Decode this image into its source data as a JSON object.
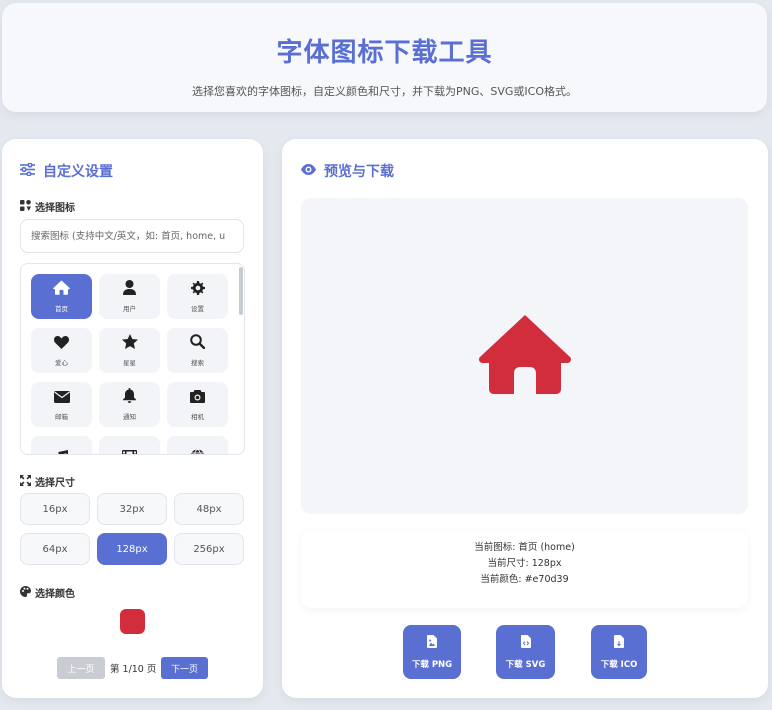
{
  "header": {
    "title": "字体图标下载工具",
    "subtitle": "选择您喜欢的字体图标，自定义颜色和尺寸，并下载为PNG、SVG或ICO格式。"
  },
  "left_panel": {
    "title": "自定义设置",
    "select_icon_label": "选择图标",
    "search_placeholder": "搜索图标 (支持中文/英文，如: 首页, home, u",
    "icons": [
      {
        "name": "home-icon",
        "label": "首页",
        "active": true
      },
      {
        "name": "user-icon",
        "label": "用户",
        "active": false
      },
      {
        "name": "gear-icon",
        "label": "设置",
        "active": false
      },
      {
        "name": "heart-icon",
        "label": "爱心",
        "active": false
      },
      {
        "name": "star-icon",
        "label": "星星",
        "active": false
      },
      {
        "name": "search-icon",
        "label": "搜索",
        "active": false
      },
      {
        "name": "envelope-icon",
        "label": "邮箱",
        "active": false
      },
      {
        "name": "bell-icon",
        "label": "通知",
        "active": false
      },
      {
        "name": "camera-icon",
        "label": "相机",
        "active": false
      },
      {
        "name": "music-icon",
        "label": "",
        "active": false
      },
      {
        "name": "film-icon",
        "label": "",
        "active": false
      },
      {
        "name": "globe-icon",
        "label": "",
        "active": false
      }
    ],
    "select_size_label": "选择尺寸",
    "sizes": [
      "16px",
      "32px",
      "48px",
      "64px",
      "128px",
      "256px"
    ],
    "selected_size": "128px",
    "select_color_label": "选择颜色",
    "selected_color": "#d22d3d",
    "pager": {
      "prev_label": "上一页",
      "info": "第 1/10 页",
      "next_label": "下一页"
    }
  },
  "right_panel": {
    "title": "预览与下载",
    "preview_icon": "home-icon",
    "preview_color": "#d22d3d",
    "info": {
      "current_icon": "当前图标: 首页 (home)",
      "current_size": "当前尺寸: 128px",
      "current_color": "当前颜色: #e70d39"
    },
    "downloads": [
      {
        "label": "下载 PNG",
        "icon": "file-image-icon"
      },
      {
        "label": "下载 SVG",
        "icon": "file-code-icon"
      },
      {
        "label": "下载 ICO",
        "icon": "file-icon"
      }
    ]
  },
  "colors": {
    "accent": "#5a6fd2",
    "background": "#e4e8ef"
  }
}
